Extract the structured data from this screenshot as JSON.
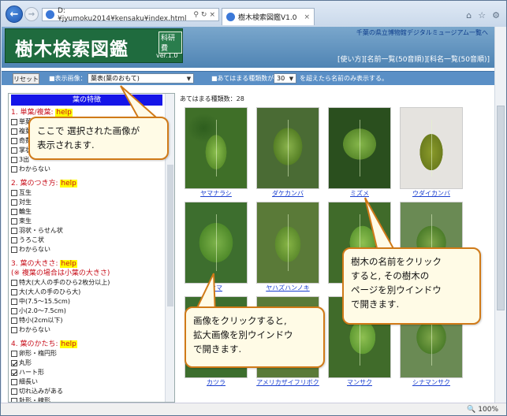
{
  "browser": {
    "url": "D:¥jyumoku2014¥kensaku¥index.html",
    "tab_title": "樹木検索図鑑V1.0",
    "zoom": "100%"
  },
  "header": {
    "title": "樹木検索図鑑",
    "badge": "科研費",
    "version": "ver.1.0",
    "museum_link": "千葉の県立博物館デジタルミュージアム一覧へ",
    "nav_links": "[使い方][名前一覧(50音順)][科名一覧(50音順)]"
  },
  "toolbar": {
    "reset_label": "リセット",
    "display_image_label": "■表示画像：",
    "display_image_value": "葉表(葉のおもて)",
    "count_label": "■あてはまる種類数が",
    "count_value": "30",
    "count_suffix": "を超えたら名前のみ表示する。"
  },
  "sidebar": {
    "heading": "葉の特徴",
    "sections": [
      {
        "title": "1. 単葉/複葉:",
        "help": "help",
        "note": "",
        "options": [
          {
            "label": "単葉",
            "checked": false
          },
          {
            "label": "複葉",
            "checked": false
          },
          {
            "label": "奇数羽状",
            "checked": false
          },
          {
            "label": "掌状",
            "checked": false
          },
          {
            "label": "3出",
            "checked": false
          },
          {
            "label": "わからない",
            "checked": false
          }
        ]
      },
      {
        "title": "2. 葉のつき方:",
        "help": "help",
        "note": "",
        "options": [
          {
            "label": "互生",
            "checked": false
          },
          {
            "label": "対生",
            "checked": false
          },
          {
            "label": "輪生",
            "checked": false
          },
          {
            "label": "束生",
            "checked": false
          },
          {
            "label": "羽状・らせん状",
            "checked": false
          },
          {
            "label": "うろこ状",
            "checked": false
          },
          {
            "label": "わからない",
            "checked": false
          }
        ]
      },
      {
        "title": "3. 葉の大きさ:",
        "help": "help",
        "note": "(※ 複葉の場合は小葉の大きさ)",
        "options": [
          {
            "label": "特大(大人の手のひら2枚分以上)",
            "checked": false
          },
          {
            "label": "大(大人の手のひら大)",
            "checked": false
          },
          {
            "label": "中(7.5～15.5cm)",
            "checked": false
          },
          {
            "label": "小(2.0～7.5cm)",
            "checked": false
          },
          {
            "label": "特小(2cm以下)",
            "checked": false
          },
          {
            "label": "わからない",
            "checked": false
          }
        ]
      },
      {
        "title": "4. 葉のかたち:",
        "help": "help",
        "note": "",
        "options": [
          {
            "label": "卵形・楕円形",
            "checked": false
          },
          {
            "label": "丸形",
            "checked": true
          },
          {
            "label": "ハート形",
            "checked": true
          },
          {
            "label": "細長い",
            "checked": false
          },
          {
            "label": "切れ込みがある",
            "checked": false
          },
          {
            "label": "針形・線形",
            "checked": false
          }
        ]
      }
    ]
  },
  "results": {
    "count_text": "あてはまる種類数：28",
    "items": [
      {
        "name": "ヤマナラシ"
      },
      {
        "name": "ダケカンバ"
      },
      {
        "name": "ミズメ"
      },
      {
        "name": "ウダイカンバ"
      },
      {
        "name": "ヤマ"
      },
      {
        "name": "ヤハズハンノキ"
      },
      {
        "name": ""
      },
      {
        "name": ""
      },
      {
        "name": "カツラ"
      },
      {
        "name": "アメリカザイフリボク"
      },
      {
        "name": "マンサク"
      },
      {
        "name": "シナマンサク"
      }
    ]
  },
  "callouts": {
    "select_tip": "ここで 選択された画像が\n表示されます.",
    "name_tip": "樹木の名前をクリック\nすると, その樹木の\nページを別ウインドウ\nで開きます.",
    "image_tip": "画像をクリックすると,\n拡大画像を別ウインドウ\nで開きます."
  }
}
